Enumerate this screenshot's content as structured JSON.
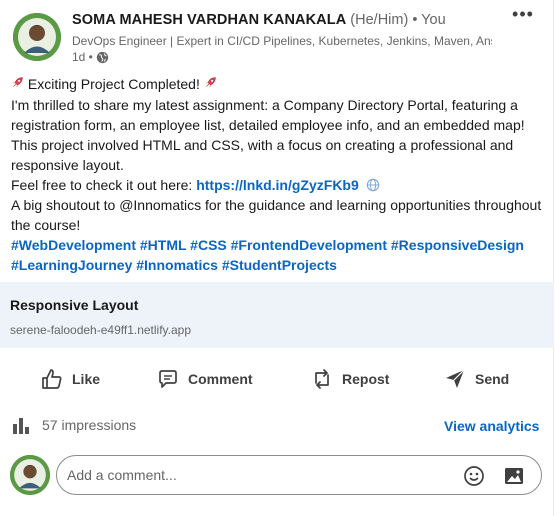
{
  "author": {
    "name": "SOMA MAHESH VARDHAN KANAKALA",
    "pronouns": "(He/Him)",
    "relation": "• You",
    "headline": "DevOps Engineer | Expert in CI/CD Pipelines, Kubernetes, Jenkins, Maven, Ansi...",
    "time": "1d •",
    "visibility_icon": "globe-icon"
  },
  "post": {
    "title": "Exciting Project Completed!",
    "paragraph1": "I'm thrilled to share my latest assignment: a Company Directory Portal, featuring a registration form, an employee list, detailed employee info, and an embedded map! This project involved HTML and CSS, with a focus on creating a professional and responsive layout.",
    "check_out_prefix": "Feel free to check it out here: ",
    "link": "https://lnkd.in/gZyzFKb9",
    "shoutout": "A big shoutout to @Innomatics for the guidance and learning opportunities throughout the course!",
    "hashtags": "#WebDevelopment #HTML #CSS #FrontendDevelopment #ResponsiveDesign #LearningJourney #Innomatics #StudentProjects"
  },
  "preview": {
    "title": "Responsive Layout",
    "url": "serene-faloodeh-e49ff1.netlify.app"
  },
  "actions": {
    "like": "Like",
    "comment": "Comment",
    "repost": "Repost",
    "send": "Send"
  },
  "stats": {
    "impressions": "57 impressions",
    "analytics": "View analytics"
  },
  "comment_box": {
    "placeholder": "Add a comment..."
  },
  "colors": {
    "link_blue": "#0a66c2",
    "preview_bg": "#edf3f8",
    "text": "#191919",
    "muted": "#666666"
  }
}
